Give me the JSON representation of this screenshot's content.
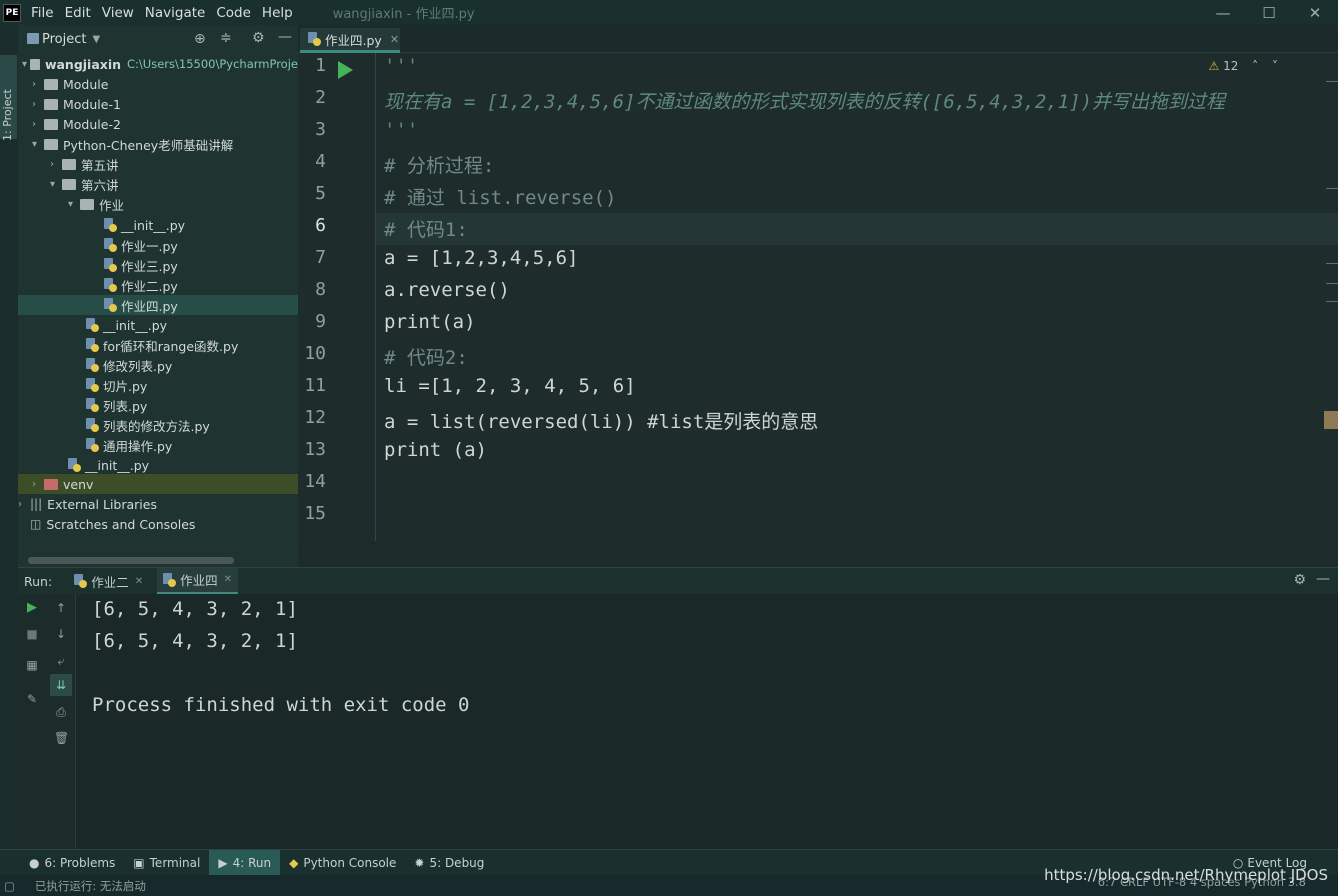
{
  "app": {
    "logo": "PE",
    "window_title": "wangjiaxin - 作业四.py",
    "menu": [
      "File",
      "Edit",
      "View",
      "Navigate",
      "Code",
      "Help"
    ],
    "window_controls": [
      "—",
      "☐",
      "✕"
    ]
  },
  "left_strip": {
    "project_tab_label": "1: Project"
  },
  "project_panel": {
    "title": "Project",
    "root_name": "wangjiaxin",
    "root_path": "C:\\Users\\15500\\PycharmProje",
    "tree": [
      {
        "label": "Module",
        "type": "folder",
        "expanded": false
      },
      {
        "label": "Module-1",
        "type": "folder",
        "expanded": false
      },
      {
        "label": "Module-2",
        "type": "folder",
        "expanded": false
      },
      {
        "label": "Python-Cheney老师基础讲解",
        "type": "folder",
        "expanded": true
      },
      {
        "label": "第五讲",
        "type": "folder",
        "expanded": false
      },
      {
        "label": "第六讲",
        "type": "folder",
        "expanded": true
      },
      {
        "label": "作业",
        "type": "folder",
        "expanded": true
      },
      {
        "label": "__init__.py",
        "type": "py"
      },
      {
        "label": "作业一.py",
        "type": "py"
      },
      {
        "label": "作业三.py",
        "type": "py"
      },
      {
        "label": "作业二.py",
        "type": "py"
      },
      {
        "label": "作业四.py",
        "type": "py",
        "selected": true
      },
      {
        "label": "__init__.py",
        "type": "py"
      },
      {
        "label": "for循环和range函数.py",
        "type": "py"
      },
      {
        "label": "修改列表.py",
        "type": "py"
      },
      {
        "label": "切片.py",
        "type": "py"
      },
      {
        "label": "列表.py",
        "type": "py"
      },
      {
        "label": "列表的修改方法.py",
        "type": "py"
      },
      {
        "label": "通用操作.py",
        "type": "py"
      },
      {
        "label": "__init__.py",
        "type": "py"
      },
      {
        "label": "venv",
        "type": "folder-red",
        "expanded": false
      },
      {
        "label": "External Libraries",
        "type": "lib"
      },
      {
        "label": "Scratches and Consoles",
        "type": "scratch"
      }
    ]
  },
  "editor": {
    "active_tab": "作业四.py",
    "inspection_count": "12",
    "current_line": 6,
    "line_numbers": [
      "1",
      "2",
      "3",
      "4",
      "5",
      "6",
      "7",
      "8",
      "9",
      "10",
      "11",
      "12",
      "13",
      "14",
      "15"
    ],
    "lines": [
      "'''",
      "现在有a = [1,2,3,4,5,6]不通过函数的形式实现列表的反转([6,5,4,3,2,1])并写出拖到过程",
      "'''",
      "# 分析过程:",
      "# 通过 list.reverse()",
      "# 代码1:",
      "a = [1,2,3,4,5,6]",
      "a.reverse()",
      "print(a)",
      "# 代码2:",
      "li =[1, 2, 3, 4, 5, 6]",
      "a = list(reversed(li)) #list是列表的意思",
      "print (a)",
      "",
      ""
    ]
  },
  "run_panel": {
    "label": "Run:",
    "tabs": [
      {
        "label": "作业二",
        "active": false
      },
      {
        "label": "作业四",
        "active": true
      }
    ],
    "output": [
      "[6, 5, 4, 3, 2, 1]",
      "[6, 5, 4, 3, 2, 1]",
      "",
      "Process finished with exit code 0"
    ]
  },
  "bottom_tools": [
    {
      "label": "6: Problems",
      "active": false
    },
    {
      "label": "Terminal",
      "active": false
    },
    {
      "label": "4: Run",
      "active": true
    },
    {
      "label": "Python Console",
      "active": false
    },
    {
      "label": "5: Debug",
      "active": false
    }
  ],
  "event_log": "Event Log",
  "watermark": "https://blog.csdn.net/Rhymeplot  JDOS",
  "status_bar": {
    "left": "已执行运行: 无法启动",
    "right": "6:7   CRLF   UTF-8   4 spaces   Python 3.8"
  },
  "colors": {
    "accent": "#3d8a7e",
    "run_green": "#45b35a",
    "docstring": "#5f8a7a",
    "number": "#e0a36a",
    "builtin": "#8e93d6"
  }
}
